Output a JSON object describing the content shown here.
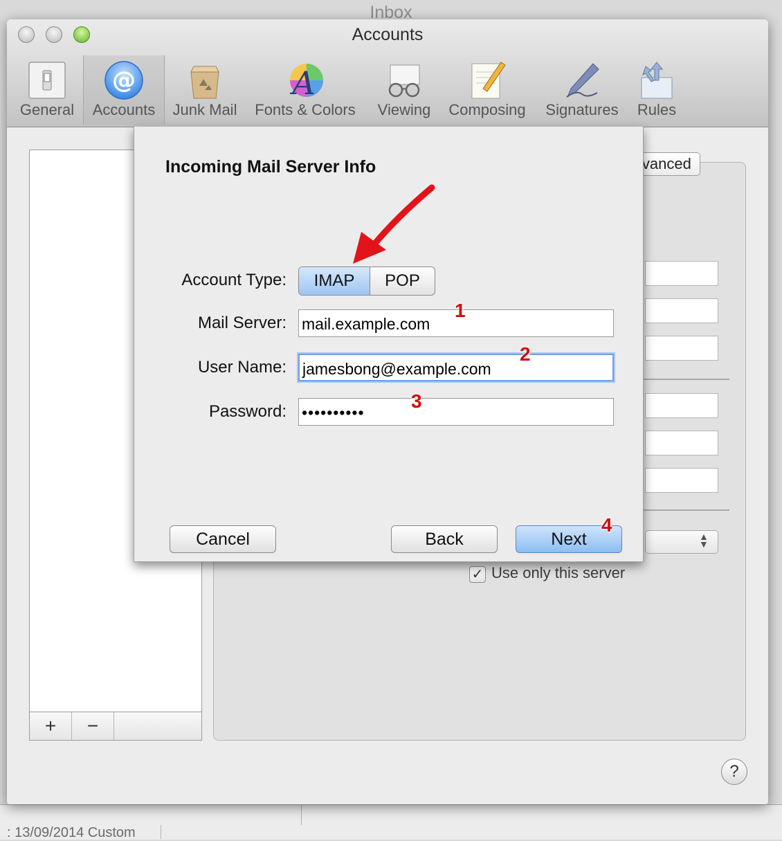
{
  "background_window": {
    "title": "Inbox",
    "footer_text": ": 13/09/2014 Custom"
  },
  "window": {
    "title": "Accounts",
    "toolbar": [
      {
        "label": "General",
        "icon": "switch-icon"
      },
      {
        "label": "Accounts",
        "icon": "at-sign-icon"
      },
      {
        "label": "Junk Mail",
        "icon": "recycle-bag-icon"
      },
      {
        "label": "Fonts & Colors",
        "icon": "letter-a-color-wheel-icon"
      },
      {
        "label": "Viewing",
        "icon": "glasses-envelope-icon"
      },
      {
        "label": "Composing",
        "icon": "pencil-paper-icon"
      },
      {
        "label": "Signatures",
        "icon": "pen-icon"
      },
      {
        "label": "Rules",
        "icon": "arrows-fork-icon"
      }
    ],
    "selected_toolbar_item": "Accounts",
    "list_buttons": {
      "add": "+",
      "remove": "−"
    },
    "advanced_tab": "Advanced",
    "use_only_server_label": "Use only this server",
    "use_only_server_checked": true,
    "help": "?"
  },
  "dialog": {
    "title": "Incoming Mail Server Info",
    "account_type_label": "Account Type:",
    "account_types": [
      "IMAP",
      "POP"
    ],
    "selected_account_type": "IMAP",
    "mail_server_label": "Mail Server:",
    "mail_server_value": "mail.example.com",
    "user_name_label": "User Name:",
    "user_name_value": "jamesbong@example.com",
    "password_label": "Password:",
    "password_value": "••••••••••",
    "cancel": "Cancel",
    "back": "Back",
    "next": "Next"
  },
  "annotations": {
    "step1": "1",
    "step2": "2",
    "step3": "3",
    "step4": "4",
    "arrow_color": "#e2141a"
  }
}
